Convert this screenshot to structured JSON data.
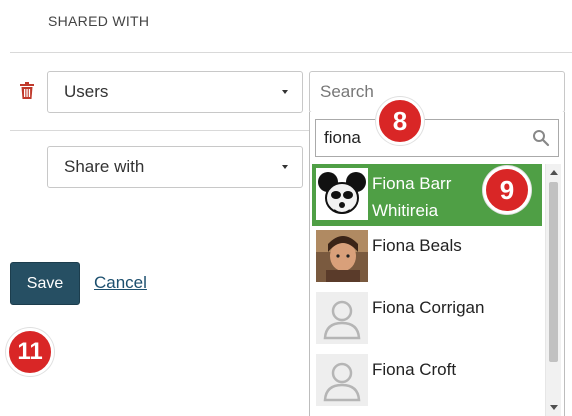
{
  "section": {
    "title": "SHARED WITH"
  },
  "type_select": {
    "value": "Users"
  },
  "share_select": {
    "value": "Share with"
  },
  "search": {
    "placeholder": "Search"
  },
  "filter": {
    "value": "fiona"
  },
  "results": [
    {
      "line1": "Fiona Barr",
      "line2": "Whitireia",
      "selected": true,
      "avatar": "cartoon-mouse"
    },
    {
      "line1": "Fiona Beals",
      "line2": "",
      "selected": false,
      "avatar": "photo"
    },
    {
      "line1": "Fiona Corrigan",
      "line2": "",
      "selected": false,
      "avatar": "default-person"
    },
    {
      "line1": "Fiona Croft",
      "line2": "",
      "selected": false,
      "avatar": "default-person"
    }
  ],
  "actions": {
    "save_label": "Save",
    "cancel_label": "Cancel"
  },
  "step_badges": {
    "b8": "8",
    "b9": "9",
    "b11": "11"
  },
  "colors": {
    "selected_row": "#4f9f45",
    "save_button": "#264f63",
    "badge": "#d92626",
    "trash": "#c0392b"
  },
  "icons": {
    "delete": "trash-icon",
    "filter": "search-icon"
  }
}
